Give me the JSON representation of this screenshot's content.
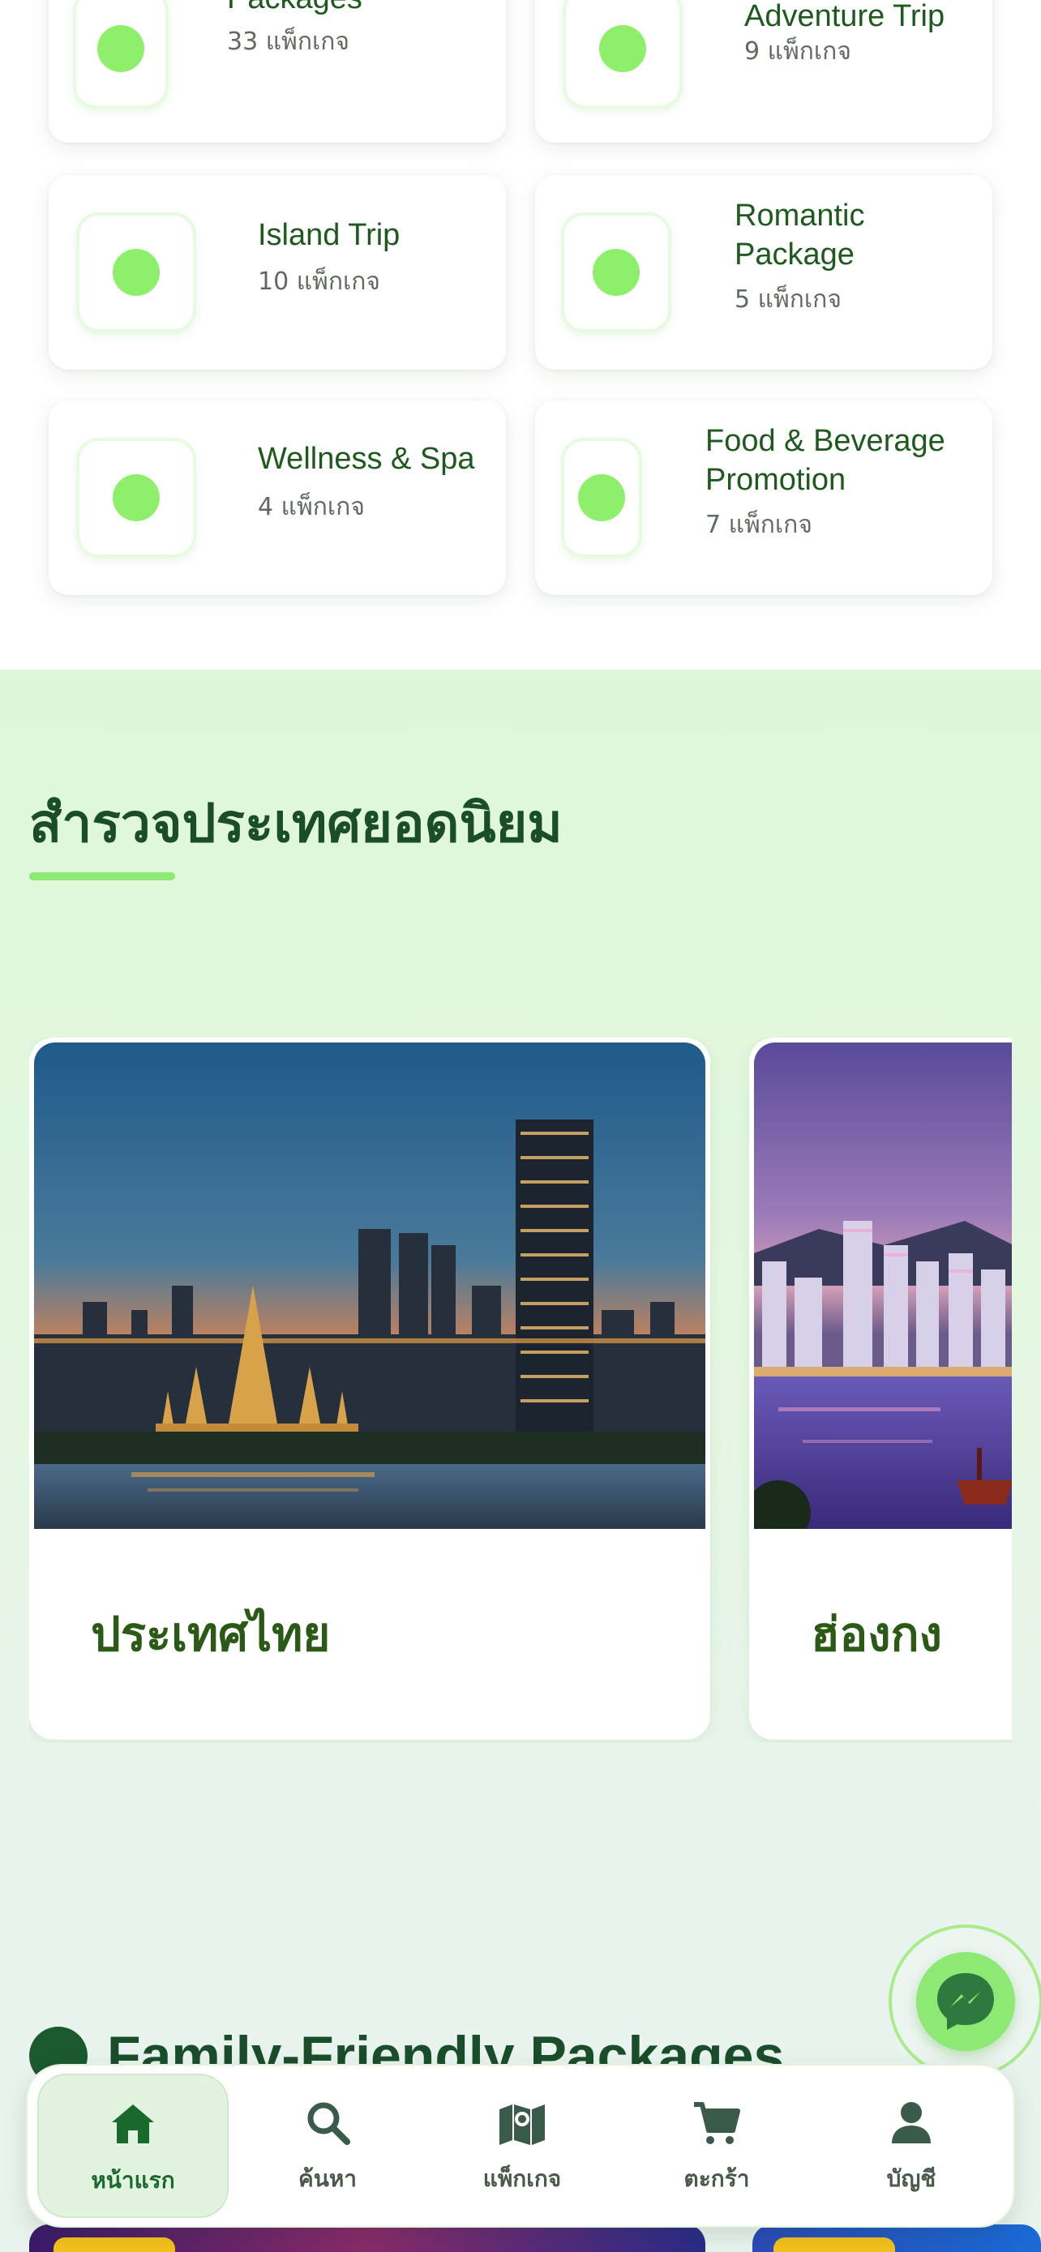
{
  "categories": [
    {
      "name": "Family-Friendly Packages",
      "count": "33 แพ็กเกจ",
      "icon": "dot-icon"
    },
    {
      "name": "Adventure Trip",
      "count": "9 แพ็กเกจ",
      "icon": "dot-icon"
    },
    {
      "name": "Island Trip",
      "count": "10 แพ็กเกจ",
      "icon": "dot-icon"
    },
    {
      "name": "Romantic Package",
      "count": "5 แพ็กเกจ",
      "icon": "dot-icon"
    },
    {
      "name": "Wellness & Spa",
      "count": "4 แพ็กเกจ",
      "icon": "dot-icon"
    },
    {
      "name": "Food & Beverage Promotion",
      "count": "7 แพ็กเกจ",
      "icon": "dot-icon"
    }
  ],
  "destinations": {
    "title": "สำรวจประเทศยอดนิยม",
    "items": [
      {
        "name": "ประเทศไทย",
        "image": "bangkok-wat-arun-night-photo"
      },
      {
        "name": "ฮ่องกง",
        "image": "hong-kong-skyline-photo"
      }
    ]
  },
  "family": {
    "title": "Family-Friendly Packages"
  },
  "fab": {
    "icon": "messenger-icon"
  },
  "nav": [
    {
      "label": "หน้าแรก",
      "icon": "home-icon",
      "active": true
    },
    {
      "label": "ค้นหา",
      "icon": "search-icon",
      "active": false
    },
    {
      "label": "แพ็กเกจ",
      "icon": "map-icon",
      "active": false
    },
    {
      "label": "ตะกร้า",
      "icon": "cart-icon",
      "active": false
    },
    {
      "label": "บัญชี",
      "icon": "user-icon",
      "active": false
    }
  ],
  "colors": {
    "primary_dark": "#1a4d2a",
    "accent_green": "#8ee874",
    "icon_dot": "#8ef06a",
    "badge_yellow": "#f6c21c"
  }
}
